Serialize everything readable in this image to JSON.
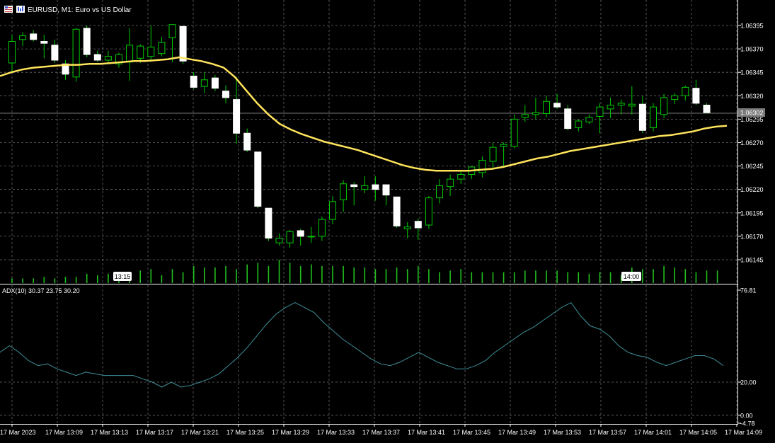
{
  "header": {
    "symbol_title": "EURUSD, M1:  Euro vs US Dollar"
  },
  "price_panel": {
    "current_price_label": "1.06302",
    "time_markers": [
      "13:15",
      "14:00"
    ],
    "colors": {
      "background": "#000000",
      "grid": "#c0c0c0",
      "bull_body": "#000000",
      "bull_outline": "#00cc00",
      "bear_body": "#ffffff",
      "wick": "#00cc00",
      "moving_average": "#ffe45c",
      "volume": "#22c01e",
      "current_price_line": "#7a7a7a"
    }
  },
  "indicator_panel": {
    "label": "ADX(10) 30.37 23.75 30.20",
    "y_tick_labels": [
      "76.81",
      "20.00",
      "0.00",
      "-4.78"
    ],
    "line_color": "#3f8f9a"
  },
  "x_axis": {
    "tick_labels": [
      "17 Mar 2023",
      "17 Mar 13:09",
      "17 Mar 13:13",
      "17 Mar 13:17",
      "17 Mar 13:21",
      "17 Mar 13:25",
      "17 Mar 13:29",
      "17 Mar 13:33",
      "17 Mar 13:37",
      "17 Mar 13:41",
      "17 Mar 13:45",
      "17 Mar 13:49",
      "17 Mar 13:53",
      "17 Mar 13:57",
      "17 Mar 14:01",
      "17 Mar 14:05",
      "17 Mar 14:09"
    ]
  },
  "chart_data": [
    {
      "type": "candlestick",
      "title": "EURUSD, M1:  Euro vs US Dollar",
      "ylim": [
        1.06135,
        1.06415
      ],
      "y_ticks": [
        "1.06395",
        "1.06370",
        "1.06345",
        "1.06320",
        "1.06295",
        "1.06270",
        "1.06245",
        "1.06220",
        "1.06195",
        "1.06170",
        "1.06145"
      ],
      "grid": true,
      "candles": [
        {
          "o": 1.06355,
          "h": 1.06385,
          "l": 1.06345,
          "c": 1.06378
        },
        {
          "o": 1.0638,
          "h": 1.06388,
          "l": 1.06373,
          "c": 1.06384
        },
        {
          "o": 1.06386,
          "h": 1.0639,
          "l": 1.06378,
          "c": 1.0638
        },
        {
          "o": 1.06378,
          "h": 1.06385,
          "l": 1.0636,
          "c": 1.06376
        },
        {
          "o": 1.06374,
          "h": 1.0638,
          "l": 1.06355,
          "c": 1.06358
        },
        {
          "o": 1.06354,
          "h": 1.06358,
          "l": 1.06337,
          "c": 1.06343
        },
        {
          "o": 1.0634,
          "h": 1.06392,
          "l": 1.06335,
          "c": 1.06391
        },
        {
          "o": 1.06392,
          "h": 1.06395,
          "l": 1.06361,
          "c": 1.06364
        },
        {
          "o": 1.06364,
          "h": 1.06368,
          "l": 1.06356,
          "c": 1.06358
        },
        {
          "o": 1.06358,
          "h": 1.06368,
          "l": 1.06354,
          "c": 1.06362
        },
        {
          "o": 1.06354,
          "h": 1.06366,
          "l": 1.0635,
          "c": 1.06364
        },
        {
          "o": 1.06356,
          "h": 1.06392,
          "l": 1.06336,
          "c": 1.06374
        },
        {
          "o": 1.0636,
          "h": 1.06375,
          "l": 1.06355,
          "c": 1.06373
        },
        {
          "o": 1.06362,
          "h": 1.06395,
          "l": 1.06356,
          "c": 1.06372
        },
        {
          "o": 1.06365,
          "h": 1.06383,
          "l": 1.06362,
          "c": 1.06377
        },
        {
          "o": 1.06382,
          "h": 1.06396,
          "l": 1.06356,
          "c": 1.06396
        },
        {
          "o": 1.06394,
          "h": 1.06394,
          "l": 1.06354,
          "c": 1.06357
        },
        {
          "o": 1.06341,
          "h": 1.06345,
          "l": 1.06327,
          "c": 1.06329
        },
        {
          "o": 1.0633,
          "h": 1.06345,
          "l": 1.06323,
          "c": 1.06337
        },
        {
          "o": 1.06339,
          "h": 1.06342,
          "l": 1.06325,
          "c": 1.06328
        },
        {
          "o": 1.06325,
          "h": 1.06331,
          "l": 1.06312,
          "c": 1.06318
        },
        {
          "o": 1.06316,
          "h": 1.0634,
          "l": 1.06269,
          "c": 1.0628
        },
        {
          "o": 1.0628,
          "h": 1.06285,
          "l": 1.0626,
          "c": 1.06262
        },
        {
          "o": 1.0626,
          "h": 1.0626,
          "l": 1.062,
          "c": 1.06202
        },
        {
          "o": 1.062,
          "h": 1.062,
          "l": 1.06165,
          "c": 1.06168
        },
        {
          "o": 1.06163,
          "h": 1.06173,
          "l": 1.0616,
          "c": 1.06168
        },
        {
          "o": 1.06163,
          "h": 1.06177,
          "l": 1.06158,
          "c": 1.06175
        },
        {
          "o": 1.06176,
          "h": 1.06178,
          "l": 1.0616,
          "c": 1.0617
        },
        {
          "o": 1.0617,
          "h": 1.0618,
          "l": 1.06163,
          "c": 1.0617
        },
        {
          "o": 1.0617,
          "h": 1.06191,
          "l": 1.06165,
          "c": 1.06188
        },
        {
          "o": 1.06188,
          "h": 1.06213,
          "l": 1.06183,
          "c": 1.06207
        },
        {
          "o": 1.06209,
          "h": 1.0623,
          "l": 1.06196,
          "c": 1.06226
        },
        {
          "o": 1.06225,
          "h": 1.06228,
          "l": 1.06203,
          "c": 1.06223
        },
        {
          "o": 1.0622,
          "h": 1.06234,
          "l": 1.06216,
          "c": 1.06224
        },
        {
          "o": 1.06225,
          "h": 1.06234,
          "l": 1.06208,
          "c": 1.0622
        },
        {
          "o": 1.06225,
          "h": 1.06225,
          "l": 1.06203,
          "c": 1.06214
        },
        {
          "o": 1.06212,
          "h": 1.06212,
          "l": 1.06179,
          "c": 1.06181
        },
        {
          "o": 1.06178,
          "h": 1.06185,
          "l": 1.06168,
          "c": 1.0618
        },
        {
          "o": 1.06186,
          "h": 1.06189,
          "l": 1.06166,
          "c": 1.06179
        },
        {
          "o": 1.06182,
          "h": 1.06213,
          "l": 1.06178,
          "c": 1.06211
        },
        {
          "o": 1.06211,
          "h": 1.06231,
          "l": 1.06205,
          "c": 1.06224
        },
        {
          "o": 1.06223,
          "h": 1.06236,
          "l": 1.06213,
          "c": 1.06231
        },
        {
          "o": 1.06231,
          "h": 1.0624,
          "l": 1.06226,
          "c": 1.06236
        },
        {
          "o": 1.06236,
          "h": 1.06245,
          "l": 1.06231,
          "c": 1.06244
        },
        {
          "o": 1.06238,
          "h": 1.06255,
          "l": 1.06233,
          "c": 1.06251
        },
        {
          "o": 1.0625,
          "h": 1.0627,
          "l": 1.06242,
          "c": 1.06265
        },
        {
          "o": 1.06266,
          "h": 1.0627,
          "l": 1.06243,
          "c": 1.06268
        },
        {
          "o": 1.06266,
          "h": 1.063,
          "l": 1.06264,
          "c": 1.06295
        },
        {
          "o": 1.06297,
          "h": 1.0631,
          "l": 1.06292,
          "c": 1.063
        },
        {
          "o": 1.063,
          "h": 1.06318,
          "l": 1.06295,
          "c": 1.06302
        },
        {
          "o": 1.06301,
          "h": 1.0632,
          "l": 1.06297,
          "c": 1.06314
        },
        {
          "o": 1.06312,
          "h": 1.06322,
          "l": 1.06306,
          "c": 1.06308
        },
        {
          "o": 1.06306,
          "h": 1.0631,
          "l": 1.06283,
          "c": 1.06285
        },
        {
          "o": 1.06286,
          "h": 1.06295,
          "l": 1.06282,
          "c": 1.06293
        },
        {
          "o": 1.06292,
          "h": 1.063,
          "l": 1.0629,
          "c": 1.06297
        },
        {
          "o": 1.06298,
          "h": 1.06312,
          "l": 1.0628,
          "c": 1.06308
        },
        {
          "o": 1.06306,
          "h": 1.06318,
          "l": 1.06296,
          "c": 1.0631
        },
        {
          "o": 1.0631,
          "h": 1.06316,
          "l": 1.063,
          "c": 1.06312
        },
        {
          "o": 1.06309,
          "h": 1.0633,
          "l": 1.063,
          "c": 1.06311
        },
        {
          "o": 1.06311,
          "h": 1.0632,
          "l": 1.0628,
          "c": 1.06283
        },
        {
          "o": 1.06286,
          "h": 1.06312,
          "l": 1.06282,
          "c": 1.06308
        },
        {
          "o": 1.063,
          "h": 1.06322,
          "l": 1.06296,
          "c": 1.06318
        },
        {
          "o": 1.06316,
          "h": 1.06323,
          "l": 1.06311,
          "c": 1.0632
        },
        {
          "o": 1.0632,
          "h": 1.06331,
          "l": 1.06315,
          "c": 1.06329
        },
        {
          "o": 1.06328,
          "h": 1.06337,
          "l": 1.0631,
          "c": 1.06312
        },
        {
          "o": 1.0631,
          "h": 1.06312,
          "l": 1.06301,
          "c": 1.06302
        }
      ],
      "volume": [
        3,
        3,
        3,
        4,
        3,
        4,
        4,
        6,
        5,
        6,
        5,
        5,
        8,
        9,
        5,
        9,
        7,
        11,
        10,
        10,
        11,
        9,
        12,
        13,
        11,
        15,
        13,
        11,
        12,
        11,
        11,
        11,
        10,
        10,
        9,
        9,
        10,
        9,
        11,
        9,
        7,
        8,
        9,
        7,
        7,
        7,
        7,
        7,
        8,
        8,
        8,
        8,
        7,
        7,
        6,
        7,
        7,
        5,
        10,
        9,
        9,
        11,
        10,
        9,
        7,
        8,
        8
      ],
      "moving_average": [
        1.06341,
        1.06345,
        1.06348,
        1.0635,
        1.06351,
        1.06352,
        1.06353,
        1.06353,
        1.06354,
        1.06354,
        1.06355,
        1.06356,
        1.06357,
        1.06357,
        1.06358,
        1.06359,
        1.06361,
        1.06359,
        1.06357,
        1.06354,
        1.0635,
        1.0634,
        1.06326,
        1.06312,
        1.063,
        1.0629,
        1.06284,
        1.06279,
        1.06275,
        1.06271,
        1.06268,
        1.06265,
        1.06262,
        1.06258,
        1.06254,
        1.0625,
        1.06246,
        1.06243,
        1.06241,
        1.0624,
        1.0624,
        1.0624,
        1.0624,
        1.06241,
        1.06242,
        1.06244,
        1.06247,
        1.0625,
        1.06253,
        1.06255,
        1.06258,
        1.06261,
        1.06263,
        1.06265,
        1.06267,
        1.06269,
        1.06271,
        1.06273,
        1.06275,
        1.06277,
        1.06278,
        1.0628,
        1.06282,
        1.06285,
        1.06287,
        1.06288
      ]
    },
    {
      "type": "line",
      "title": "ADX(10) 30.37 23.75 30.20",
      "ylim": [
        -4.78,
        76.81
      ],
      "y_ticks": [
        76.81,
        20.0,
        0.0,
        -4.78
      ],
      "grid": true,
      "series": [
        {
          "name": "ADX(10)",
          "values": [
            38,
            42,
            38,
            33,
            30,
            31,
            28,
            26,
            24,
            26,
            25,
            24,
            24,
            24,
            24,
            22,
            20,
            17,
            20,
            17,
            18,
            20,
            22,
            25,
            30,
            35,
            41,
            48,
            55,
            61,
            65,
            68,
            65,
            62,
            56,
            51,
            46,
            42,
            38,
            34,
            31,
            30,
            32,
            35,
            38,
            35,
            32,
            30,
            28,
            28,
            30,
            33,
            38,
            42,
            46,
            50,
            53,
            57,
            61,
            65,
            68,
            60,
            54,
            52,
            48,
            42,
            38,
            36,
            35,
            32,
            30,
            32,
            34,
            36,
            36,
            34,
            30
          ]
        }
      ]
    }
  ]
}
